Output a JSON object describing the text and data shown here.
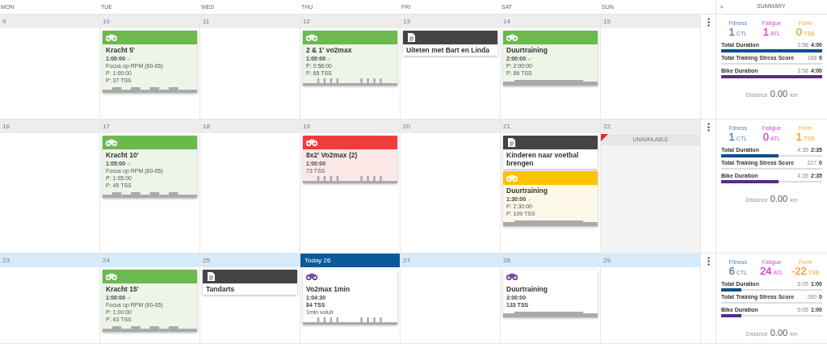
{
  "weekdays": [
    "MON",
    "TUE",
    "WED",
    "THU",
    "FRI",
    "SAT",
    "SUN"
  ],
  "summary_header": {
    "toggle": ">",
    "title": "SUMMARY"
  },
  "weeks": [
    {
      "current": false,
      "days": [
        {
          "date": "9",
          "today": false
        },
        {
          "date": "10",
          "today": false,
          "events": [
            {
              "kind": "completed",
              "title": "Kracht 5'",
              "duration": "1:00:00",
              "checked": true,
              "lines": [
                {
                  "text": "Focus op RPM (60-65)",
                  "bold": false
                },
                {
                  "text": "P: 1:00:00",
                  "bold": false
                },
                {
                  "text": "P: 37 TSS",
                  "bold": false
                }
              ]
            }
          ]
        },
        {
          "date": "11",
          "today": false
        },
        {
          "date": "12",
          "today": false,
          "events": [
            {
              "kind": "completed",
              "title": "2 & 1' vo2max",
              "duration": "1:00:00",
              "checked": true,
              "lines": [
                {
                  "text": "P: 0:58:00",
                  "bold": false
                },
                {
                  "text": "P: 65 TSS",
                  "bold": false
                }
              ]
            }
          ]
        },
        {
          "date": "13",
          "today": false,
          "events": [
            {
              "kind": "note",
              "title": "Uiteten met Bart en Linda"
            }
          ]
        },
        {
          "date": "14",
          "today": false,
          "events": [
            {
              "kind": "completed",
              "title": "Duurtraining",
              "duration": "2:00:00",
              "checked": true,
              "lines": [
                {
                  "text": "P: 2:00:00",
                  "bold": false
                },
                {
                  "text": "P: 86 TSS",
                  "bold": false
                }
              ]
            }
          ]
        },
        {
          "date": "15",
          "today": false
        }
      ],
      "summary": {
        "metrics": [
          {
            "label": "Fitness",
            "value": "1",
            "unit": "CTL",
            "color": "#5b82b0"
          },
          {
            "label": "Fatigue",
            "value": "1",
            "unit": "ATL",
            "color": "#d54bc8"
          },
          {
            "label": "Form",
            "value": "0",
            "unit": "TSB",
            "color": "#f0a52a"
          }
        ],
        "bars": [
          {
            "label": "Total Duration",
            "actual": "3:58",
            "planned": "4:00",
            "level": 1,
            "color": "#0b4f8c"
          },
          {
            "label": "Total Training Stress Score",
            "actual": "188",
            "planned": "0"
          },
          {
            "label": "Bike Duration",
            "actual": "3:58",
            "planned": "4:00",
            "level": 1,
            "color": "#5b2a86"
          }
        ],
        "distance": {
          "label": "Distance",
          "value": "0.00",
          "unit": "km"
        }
      }
    },
    {
      "current": false,
      "days": [
        {
          "date": "16",
          "today": false
        },
        {
          "date": "17",
          "today": false,
          "events": [
            {
              "kind": "completed",
              "title": "Kracht 10'",
              "duration": "1:05:00",
              "checked": true,
              "lines": [
                {
                  "text": "Focus op RPM (60-65)",
                  "bold": false
                },
                {
                  "text": "P: 1:05:00",
                  "bold": false
                },
                {
                  "text": "P: 45 TSS",
                  "bold": false
                }
              ]
            }
          ]
        },
        {
          "date": "18",
          "today": false
        },
        {
          "date": "19",
          "today": false,
          "events": [
            {
              "kind": "missed",
              "title": "8x2' Vo2max (2)",
              "duration": "1:00:00",
              "checked": false,
              "lines": [
                {
                  "text": "73 TSS",
                  "bold": false
                }
              ]
            }
          ]
        },
        {
          "date": "20",
          "today": false
        },
        {
          "date": "21",
          "today": false,
          "events": [
            {
              "kind": "note",
              "title": "Kinderen naar voetbal brengen"
            },
            {
              "kind": "partial",
              "title": "Duurtraining",
              "duration": "1:30:00",
              "checked": true,
              "lines": [
                {
                  "text": "P: 2:30:00",
                  "bold": false
                },
                {
                  "text": "P: 109 TSS",
                  "bold": false
                }
              ]
            }
          ]
        },
        {
          "date": "22",
          "today": false,
          "unavailable": "UNAVAILABLE"
        }
      ],
      "summary": {
        "metrics": [
          {
            "label": "Fitness",
            "value": "1",
            "unit": "CTL",
            "color": "#5b82b0"
          },
          {
            "label": "Fatigue",
            "value": "0",
            "unit": "ATL",
            "color": "#d54bc8"
          },
          {
            "label": "Form",
            "value": "1",
            "unit": "TSB",
            "color": "#f0a52a"
          }
        ],
        "bars": [
          {
            "label": "Total Duration",
            "actual": "4:35",
            "planned": "2:35",
            "level": 0.57,
            "color": "#0b4f8c"
          },
          {
            "label": "Total Training Stress Score",
            "actual": "227",
            "planned": "0"
          },
          {
            "label": "Bike Duration",
            "actual": "4:35",
            "planned": "2:35",
            "level": 0.57,
            "color": "#5b2a86"
          }
        ],
        "distance": {
          "label": "Distance",
          "value": "0.00",
          "unit": "km"
        }
      }
    },
    {
      "current": true,
      "days": [
        {
          "date": "23",
          "today": false
        },
        {
          "date": "24",
          "today": false,
          "events": [
            {
              "kind": "completed",
              "title": "Kracht 15'",
              "duration": "1:00:00",
              "checked": true,
              "lines": [
                {
                  "text": "Focus op RPM (60-65)",
                  "bold": false
                },
                {
                  "text": "P: 1:00:00",
                  "bold": false
                },
                {
                  "text": "P: 43 TSS",
                  "bold": false
                }
              ]
            }
          ]
        },
        {
          "date": "25",
          "today": false,
          "events": [
            {
              "kind": "note",
              "title": "Tandarts"
            }
          ]
        },
        {
          "date": "Today 26",
          "today": true,
          "events": [
            {
              "kind": "planned",
              "title": "Vo2max 1min",
              "duration": "1:04:30",
              "checked": false,
              "lines": [
                {
                  "text": "84 TSS",
                  "bold": true
                },
                {
                  "text": "1min voluit",
                  "bold": false
                }
              ]
            }
          ]
        },
        {
          "date": "27",
          "today": false
        },
        {
          "date": "28",
          "today": false,
          "events": [
            {
              "kind": "planned",
              "title": "Duurtraining",
              "duration": "3:00:00",
              "checked": false,
              "lines": [
                {
                  "text": "133 TSS",
                  "bold": true
                }
              ]
            }
          ]
        },
        {
          "date": "29",
          "today": false
        }
      ],
      "summary": {
        "metrics": [
          {
            "label": "Fitness",
            "value": "6",
            "unit": "CTL",
            "color": "#5b82b0"
          },
          {
            "label": "Fatigue",
            "value": "24",
            "unit": "ATL",
            "color": "#d54bc8"
          },
          {
            "label": "Form",
            "value": "-22",
            "unit": "TSB",
            "color": "#f0a52a"
          }
        ],
        "bars": [
          {
            "label": "Total Duration",
            "actual": "5:05",
            "planned": "1:00",
            "level": 0.2,
            "color": "#0b4f8c"
          },
          {
            "label": "Total Training Stress Score",
            "actual": "260",
            "planned": "0"
          },
          {
            "label": "Bike Duration",
            "actual": "5:05",
            "planned": "1:00",
            "level": 0.2,
            "color": "#5b2a86"
          }
        ],
        "distance": {
          "label": "Distance",
          "value": "0.00",
          "unit": "km"
        }
      }
    }
  ]
}
